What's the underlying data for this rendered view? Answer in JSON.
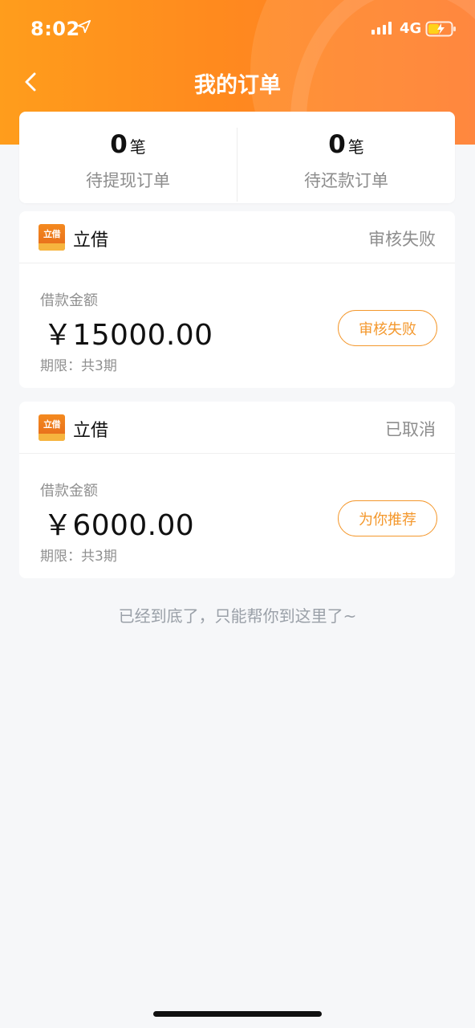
{
  "status_bar": {
    "time": "8:02",
    "network": "4G",
    "icons": [
      "location-icon",
      "signal-icon",
      "battery-icon"
    ]
  },
  "nav": {
    "title": "我的订单",
    "back_icon": "chevron-left-icon"
  },
  "summary": {
    "items": [
      {
        "count": "0",
        "unit": "笔",
        "label": "待提现订单"
      },
      {
        "count": "0",
        "unit": "笔",
        "label": "待还款订单"
      }
    ]
  },
  "orders": [
    {
      "brand_logo_text": "立借",
      "brand_name": "立借",
      "status": "审核失败",
      "amount_label": "借款金额",
      "amount": "￥15000.00",
      "term": "期限：共3期",
      "action_label": "审核失败"
    },
    {
      "brand_logo_text": "立借",
      "brand_name": "立借",
      "status": "已取消",
      "amount_label": "借款金额",
      "amount": "￥6000.00",
      "term": "期限：共3期",
      "action_label": "为你推荐"
    }
  ],
  "footer": {
    "end_text": "已经到底了，只能帮你到这里了~"
  },
  "colors": {
    "header_orange": "#ff8a1e",
    "button_orange": "#f4982d",
    "background": "#f6f7f9",
    "muted_text": "#8d8d8d"
  }
}
